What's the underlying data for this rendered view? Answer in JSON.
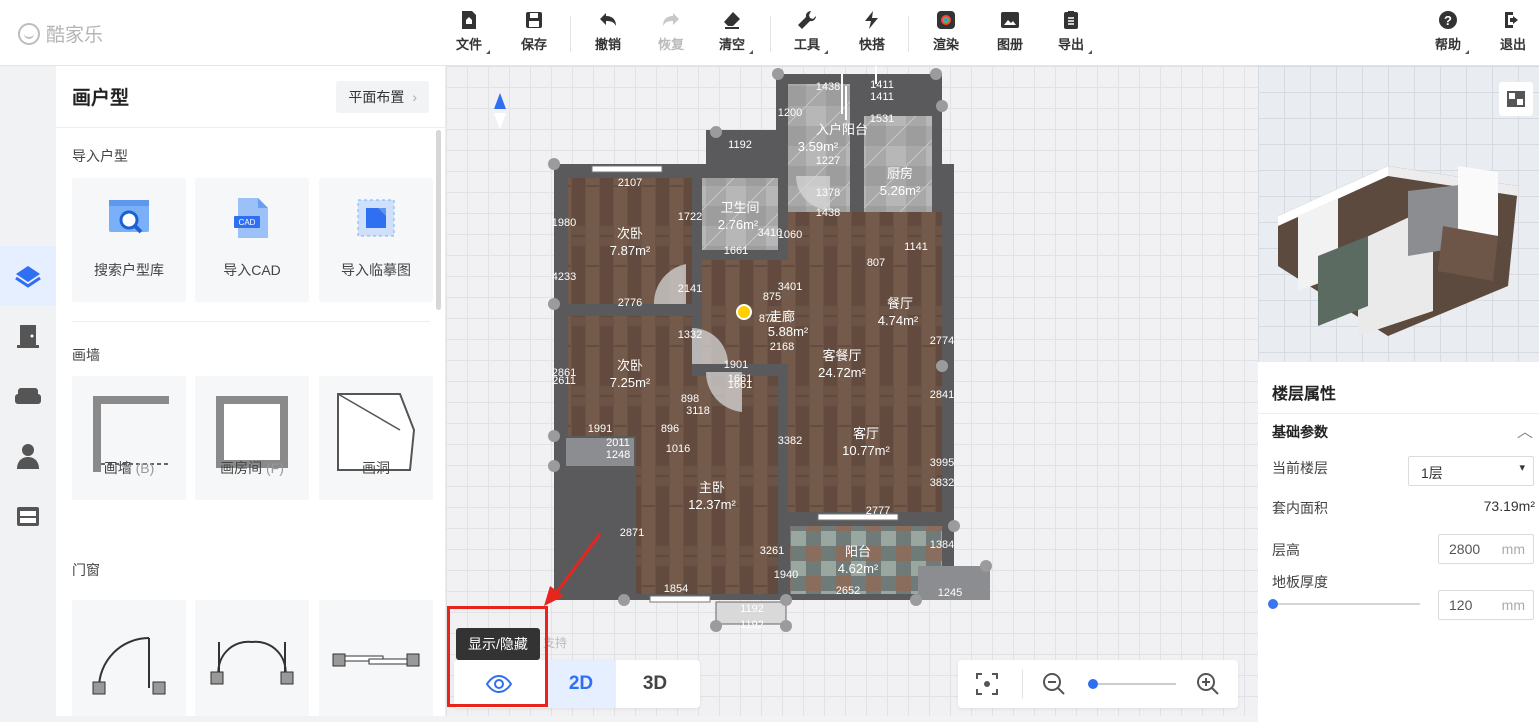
{
  "brand": {
    "name": "酷家乐"
  },
  "toolbar": {
    "file": "文件",
    "save": "保存",
    "undo": "撤销",
    "redo": "恢复",
    "clear": "清空",
    "tools": "工具",
    "quick": "快搭",
    "render": "渲染",
    "album": "图册",
    "export": "导出",
    "help": "帮助",
    "exit": "退出"
  },
  "left_panel": {
    "title": "画户型",
    "layout_button": "平面布置",
    "import_section": "导入户型",
    "import_items": [
      {
        "label": "搜索户型库"
      },
      {
        "label": "导入CAD",
        "badge": "CAD"
      },
      {
        "label": "导入临摹图"
      }
    ],
    "wall_section": "画墙",
    "wall_items": [
      {
        "label": "画墙",
        "key": "(B)"
      },
      {
        "label": "画房间",
        "key": "(F)"
      },
      {
        "label": "画洞"
      }
    ],
    "door_section": "门窗"
  },
  "floorplan": {
    "rooms": [
      {
        "name": "入户阳台",
        "area": "3.59m²"
      },
      {
        "name": "厨房",
        "area": "5.26m²"
      },
      {
        "name": "卫生间",
        "area": "2.76m²"
      },
      {
        "name": "次卧",
        "area": "7.87m²"
      },
      {
        "name": "餐厅",
        "area": "4.74m²"
      },
      {
        "name": "走廊",
        "area": "5.88m²",
        "prefix": "875"
      },
      {
        "name": "次卧",
        "area": "7.25m²"
      },
      {
        "name": "客餐厅",
        "area": "24.72m²"
      },
      {
        "name": "客厅",
        "area": "10.77m²"
      },
      {
        "name": "主卧",
        "area": "12.37m²"
      },
      {
        "name": "阳台",
        "area": "4.62m²"
      }
    ],
    "dimensions": [
      "1438",
      "1411",
      "1411",
      "1200",
      "1531",
      "1192",
      "1227",
      "1378",
      "1438",
      "2107",
      "1722",
      "1980",
      "1661",
      "3410",
      "1060",
      "875",
      "1141",
      "807",
      "2861",
      "1661",
      "2776",
      "2141",
      "1332",
      "3401",
      "2774",
      "2611",
      "1901",
      "1661",
      "898",
      "3382",
      "2168",
      "3118",
      "1991",
      "896",
      "1016",
      "2871",
      "2777",
      "1940",
      "3261",
      "3995",
      "2011",
      "1248",
      "1384",
      "1854",
      "1192",
      "1192",
      "2652",
      "1245",
      "3832",
      "2841",
      "4233"
    ]
  },
  "view": {
    "tooltip": "显示/隐藏",
    "tooltip_ghost": "支持",
    "mode_2d": "2D",
    "mode_3d": "3D"
  },
  "right_panel": {
    "section_title": "楼层属性",
    "group_title": "基础参数",
    "current_floor_label": "当前楼层",
    "current_floor_value": "1层",
    "area_label": "套内面积",
    "area_value": "73.19m²",
    "height_label": "层高",
    "height_value": "2800",
    "height_unit": "mm",
    "floor_thickness_label": "地板厚度",
    "floor_thickness_value": "120",
    "floor_thickness_unit": "mm",
    "floor_thickness_slider": 0
  },
  "colors": {
    "accent": "#2f6ff1",
    "highlight": "#e7251c",
    "wall": "#5a5a5c",
    "wood": "#6b5446"
  }
}
